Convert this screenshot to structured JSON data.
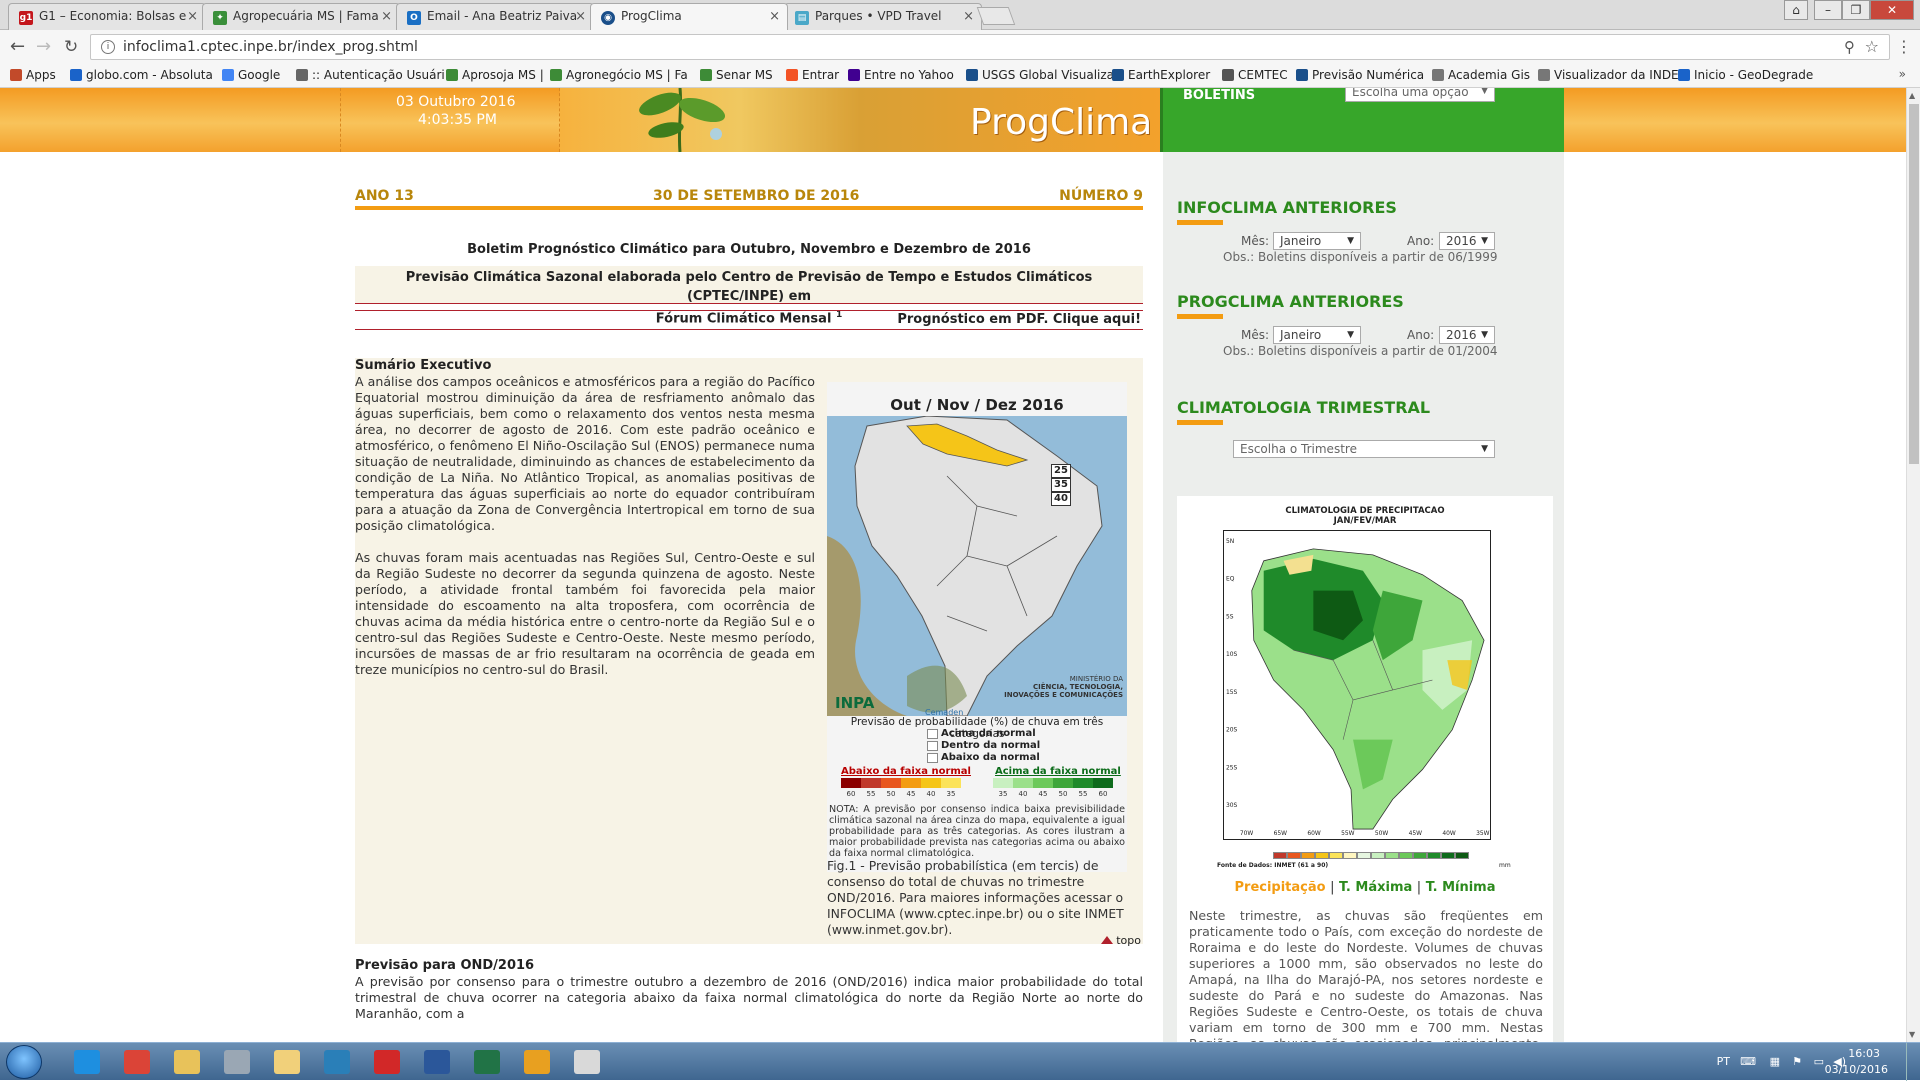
{
  "browser": {
    "tabs": [
      {
        "label": "G1 – Economia: Bolsas e",
        "icon": "g1-icon",
        "color": "#c4161c"
      },
      {
        "label": "Agropecuária MS | Fama",
        "icon": "leaf-icon",
        "color": "#3a8f3a"
      },
      {
        "label": "Email - Ana Beatriz Paiva",
        "icon": "outlook-icon",
        "color": "#1a6fc4"
      },
      {
        "label": "ProgClima",
        "icon": "cptec-icon",
        "color": "#1a4f8a",
        "active": true
      },
      {
        "label": "Parques • VPD Travel",
        "icon": "page-icon",
        "color": "#4aa8c8"
      }
    ],
    "url": "infoclima1.cptec.inpe.br/index_prog.shtml",
    "bookmarks": [
      {
        "label": "Apps",
        "icon": "apps-grid-icon",
        "color": "#c24a2a"
      },
      {
        "label": "globo.com - Absoluta",
        "icon": "globo-icon",
        "color": "#1a63c9"
      },
      {
        "label": "Google",
        "icon": "google-icon",
        "color": "#4285f4"
      },
      {
        "label": ":: Autenticação Usuári",
        "icon": "key-icon",
        "color": "#666666"
      },
      {
        "label": "Aprosoja MS |",
        "icon": "aprosoja-icon",
        "color": "#3d8b37"
      },
      {
        "label": "Agronegócio MS | Fa",
        "icon": "leaf-icon",
        "color": "#3d8b37"
      },
      {
        "label": "Senar MS",
        "icon": "senar-icon",
        "color": "#3d8b37"
      },
      {
        "label": "Entrar",
        "icon": "windows-icon",
        "color": "#f35325"
      },
      {
        "label": "Entre no Yahoo",
        "icon": "yahoo-icon",
        "color": "#400090"
      },
      {
        "label": "USGS Global Visualiza",
        "icon": "globe-icon",
        "color": "#1a4f8a"
      },
      {
        "label": "EarthExplorer",
        "icon": "ee-icon",
        "color": "#1a4f8a"
      },
      {
        "label": "CEMTEC",
        "icon": "cemtec-icon",
        "color": "#555555"
      },
      {
        "label": "Previsão Numérica",
        "icon": "cloud-icon",
        "color": "#1a4f8a"
      },
      {
        "label": "Academia Gis",
        "icon": "page-icon",
        "color": "#777777"
      },
      {
        "label": "Visualizador da INDE",
        "icon": "page-icon",
        "color": "#777777"
      },
      {
        "label": "Inicio - GeoDegrade",
        "icon": "geo-icon",
        "color": "#1a63c9"
      }
    ],
    "more": "»"
  },
  "banner": {
    "date": "03 Outubro 2016",
    "time": "4:03:35 PM",
    "logo": "ProgClima",
    "boletins_label": "BOLETINS",
    "boletins_select": "Escolha uma opção"
  },
  "header": {
    "ano": "ANO 13",
    "data": "30 DE SETEMBRO DE 2016",
    "numero": "NÚMERO 9"
  },
  "boletim": {
    "title": "Boletim Prognóstico Climático para Outubro, Novembro e Dezembro de 2016",
    "previsao_line1": "Previsão Climática Sazonal elaborada pelo Centro de Previsão de Tempo e Estudos Climáticos (CPTEC/INPE) em",
    "previsao_line2": "Fórum Climático Mensal",
    "previsao_sup": "1",
    "pdf_link": "Prognóstico em PDF. Clique aqui!"
  },
  "sumario": {
    "title": "Sumário Executivo",
    "p1": "A análise dos campos oceânicos e atmosféricos para a região do Pacífico Equatorial mostrou diminuição da área de resfriamento anômalo das águas superficiais, bem como o relaxamento dos ventos nesta mesma área, no decorrer de agosto de 2016. Com este padrão oceânico e atmosférico, o fenômeno El Niño-Oscilação Sul (ENOS) permanece numa situação de neutralidade, diminuindo as chances de estabelecimento da condição de La Niña. No Atlântico Tropical, as anomalias positivas de temperatura das águas superficiais ao norte do equador contribuíram para a atuação da Zona de Convergência Intertropical em torno de sua posição climatológica.",
    "p2": "As chuvas foram mais acentuadas nas Regiões Sul, Centro-Oeste e sul da Região Sudeste no decorrer da segunda quinzena de agosto. Neste período, a atividade frontal também foi favorecida pela maior intensidade do escoamento na alta troposfera, com ocorrência de chuvas acima da média histórica entre o centro-norte da Região Sul e o centro-sul das Regiões Sudeste e Centro-Oeste. Neste mesmo período, incursões de massas de ar frio resultaram na ocorrência de geada em treze municípios no centro-sul do Brasil."
  },
  "figure": {
    "title": "Out / Nov / Dez 2016",
    "scale": [
      "25",
      "35",
      "40"
    ],
    "logo_inpa": "INPA",
    "logo_cemaden": "Cemaden",
    "ministerio_line1": "MINISTÉRIO DA",
    "ministerio_line2": "CIÊNCIA, TECNOLOGIA,",
    "ministerio_line3": "INOVAÇÕES E COMUNICAÇÕES",
    "legend_title": "Previsão de probabilidade (%) de chuva em três categorias",
    "cat1": "Acima da normal",
    "cat2": "Dentro da normal",
    "cat3": "Abaixo da normal",
    "abaixo": "Abaixo da faixa normal",
    "acima": "Acima da faixa normal",
    "below_colors": [
      "#8b0000",
      "#c0392b",
      "#e8571f",
      "#f39c12",
      "#f5c518",
      "#fbe35a"
    ],
    "above_colors": [
      "#c8f0c0",
      "#9be08a",
      "#6cc95a",
      "#3ea63a",
      "#1f8a2a",
      "#0e6b1c"
    ],
    "below_nums": [
      "60",
      "55",
      "50",
      "45",
      "40",
      "35"
    ],
    "above_nums": [
      "35",
      "40",
      "45",
      "50",
      "55",
      "60"
    ],
    "nota": "NOTA: A previsão por consenso indica baixa previsibilidade climática sazonal na área cinza do mapa, equivalente a igual probabilidade para as três categorias. As cores ilustram a maior probabilidade prevista nas categorias acima ou abaixo da faixa normal climatológica.",
    "caption": "Fig.1 - Previsão probabilística (em tercis) de consenso do total de chuvas no trimestre OND/2016. Para maiores informações acessar o INFOCLIMA (www.cptec.inpe.br) ou o site INMET (www.inmet.gov.br)."
  },
  "topo": "topo",
  "ond": {
    "title": "Previsão para OND/2016",
    "text": "A previsão por consenso para o trimestre outubro a dezembro de 2016 (OND/2016) indica maior probabilidade do total trimestral de chuva ocorrer na categoria abaixo da faixa normal climatológica do norte da Região Norte ao norte do Maranhão, com a"
  },
  "sidebar": {
    "infoclima": {
      "title": "INFOCLIMA ANTERIORES",
      "mes_label": "Mês:",
      "mes": "Janeiro",
      "ano_label": "Ano:",
      "ano": "2016",
      "obs": "Obs.: Boletins disponíveis a partir de 06/1999"
    },
    "progclima": {
      "title": "PROGCLIMA ANTERIORES",
      "mes_label": "Mês:",
      "mes": "Janeiro",
      "ano_label": "Ano:",
      "ano": "2016",
      "obs": "Obs.: Boletins disponíveis a partir de 01/2004"
    },
    "climatologia": {
      "title": "CLIMATOLOGIA TRIMESTRAL",
      "select": "Escolha o Trimestre",
      "map_title1": "CLIMATOLOGIA DE PRECIPITACAO",
      "map_title2": "JAN/FEV/MAR",
      "lat_labels": [
        "5N",
        "EQ",
        "5S",
        "10S",
        "15S",
        "20S",
        "25S",
        "30S"
      ],
      "lon_labels": [
        "70W",
        "65W",
        "60W",
        "55W",
        "50W",
        "45W",
        "40W",
        "35W"
      ],
      "source": "Fonte de Dados: INMET (61 a 90)",
      "unit": "mm",
      "link_precip": "Precipitação",
      "link_tmax": "T. Máxima",
      "link_tmin": "T. Mínima",
      "sep": "|",
      "text": "Neste trimestre, as chuvas são freqüentes em praticamente todo o País, com exceção do nordeste de Roraima e do leste do Nordeste. Volumes de chuvas superiores a 1000 mm, são observados no leste do Amapá, na Ilha do Marajó-PA, nos setores nordeste e sudeste do Pará e no sudeste do Amazonas. Nas Regiões Sudeste e Centro-Oeste, os totais de chuva variam em torno de 300 mm e 700 mm. Nestas Regiões, as chuvas são ocasionadas, principalmente, pela atuação da Zona"
    }
  },
  "taskbar": {
    "lang": "PT",
    "time": "16:03",
    "date": "03/10/2016",
    "apps": [
      {
        "name": "ie-icon",
        "color": "#1e8fe0"
      },
      {
        "name": "chrome-icon",
        "color": "#db4437"
      },
      {
        "name": "folder-icon",
        "color": "#e8c25a"
      },
      {
        "name": "calculator-icon",
        "color": "#9aa7b4"
      },
      {
        "name": "folder-yellow-icon",
        "color": "#f1d07a"
      },
      {
        "name": "magnifier-icon",
        "color": "#2a7fb8"
      },
      {
        "name": "acrobat-icon",
        "color": "#d22828"
      },
      {
        "name": "word-icon",
        "color": "#2b579a"
      },
      {
        "name": "excel-icon",
        "color": "#217346"
      },
      {
        "name": "outlook-icon",
        "color": "#e8a020"
      },
      {
        "name": "notepad-icon",
        "color": "#d9d9d9"
      }
    ]
  }
}
